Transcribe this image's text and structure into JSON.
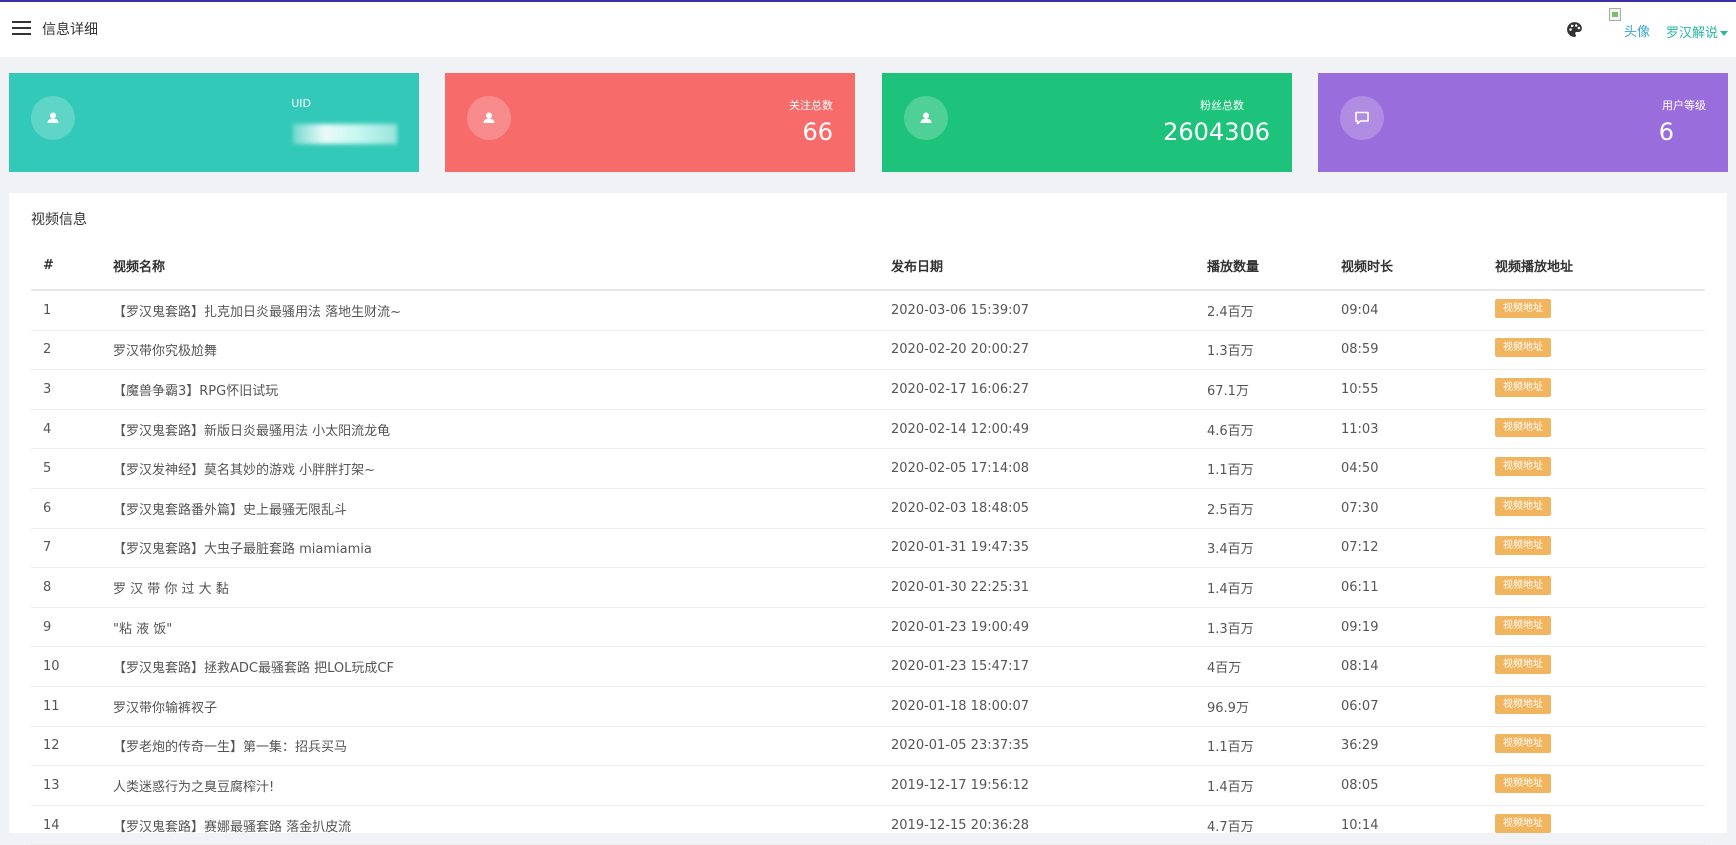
{
  "header": {
    "title": "信息详细",
    "avatar_alt": "头像",
    "user_name": "罗汉解说"
  },
  "stats": [
    {
      "label": "UID",
      "value": "",
      "color": "#33c9b8",
      "icon": "user-icon"
    },
    {
      "label": "关注总数",
      "value": "66",
      "color": "#f76b6b",
      "icon": "user-icon"
    },
    {
      "label": "粉丝总数",
      "value": "2604306",
      "color": "#1dc37a",
      "icon": "user-icon"
    },
    {
      "label": "用户等级",
      "value": "6",
      "color": "#9a6ddc",
      "icon": "comment-icon"
    }
  ],
  "video_panel": {
    "title": "视频信息",
    "columns": [
      "#",
      "视频名称",
      "发布日期",
      "播放数量",
      "视频时长",
      "视频播放地址"
    ],
    "button_color": "#f0ad4e",
    "rows": [
      {
        "idx": "1",
        "name": "【罗汉鬼套路】扎克加日炎最骚用法 落地生财流~",
        "date": "2020-03-06 15:39:07",
        "plays": "2.4百万",
        "duration": "09:04",
        "url_label": "视频地址"
      },
      {
        "idx": "2",
        "name": "罗汉带你究极尬舞",
        "date": "2020-02-20 20:00:27",
        "plays": "1.3百万",
        "duration": "08:59",
        "url_label": "视频地址"
      },
      {
        "idx": "3",
        "name": "【魔兽争霸3】RPG怀旧试玩",
        "date": "2020-02-17 16:06:27",
        "plays": "67.1万",
        "duration": "10:55",
        "url_label": "视频地址"
      },
      {
        "idx": "4",
        "name": "【罗汉鬼套路】新版日炎最骚用法 小太阳流龙龟",
        "date": "2020-02-14 12:00:49",
        "plays": "4.6百万",
        "duration": "11:03",
        "url_label": "视频地址"
      },
      {
        "idx": "5",
        "name": "【罗汉发神经】莫名其妙的游戏 小胖胖打架~",
        "date": "2020-02-05 17:14:08",
        "plays": "1.1百万",
        "duration": "04:50",
        "url_label": "视频地址"
      },
      {
        "idx": "6",
        "name": "【罗汉鬼套路番外篇】史上最骚无限乱斗",
        "date": "2020-02-03 18:48:05",
        "plays": "2.5百万",
        "duration": "07:30",
        "url_label": "视频地址"
      },
      {
        "idx": "7",
        "name": "【罗汉鬼套路】大虫子最脏套路 miamiamia",
        "date": "2020-01-31 19:47:35",
        "plays": "3.4百万",
        "duration": "07:12",
        "url_label": "视频地址"
      },
      {
        "idx": "8",
        "name": "罗 汉 带 你 过 大 黏",
        "date": "2020-01-30 22:25:31",
        "plays": "1.4百万",
        "duration": "06:11",
        "url_label": "视频地址"
      },
      {
        "idx": "9",
        "name": "\"粘 液 饭\"",
        "date": "2020-01-23 19:00:49",
        "plays": "1.3百万",
        "duration": "09:19",
        "url_label": "视频地址"
      },
      {
        "idx": "10",
        "name": "【罗汉鬼套路】拯救ADC最骚套路 把LOL玩成CF",
        "date": "2020-01-23 15:47:17",
        "plays": "4百万",
        "duration": "08:14",
        "url_label": "视频地址"
      },
      {
        "idx": "11",
        "name": "罗汉带你输裤衩子",
        "date": "2020-01-18 18:00:07",
        "plays": "96.9万",
        "duration": "06:07",
        "url_label": "视频地址"
      },
      {
        "idx": "12",
        "name": "【罗老炮的传奇一生】第一集：招兵买马",
        "date": "2020-01-05 23:37:35",
        "plays": "1.1百万",
        "duration": "36:29",
        "url_label": "视频地址"
      },
      {
        "idx": "13",
        "name": "人类迷惑行为之臭豆腐榨汁!",
        "date": "2019-12-17 19:56:12",
        "plays": "1.4百万",
        "duration": "08:05",
        "url_label": "视频地址"
      },
      {
        "idx": "14",
        "name": "【罗汉鬼套路】赛娜最骚套路 落金扒皮流",
        "date": "2019-12-15 20:36:28",
        "plays": "4.7百万",
        "duration": "10:14",
        "url_label": "视频地址"
      }
    ]
  }
}
